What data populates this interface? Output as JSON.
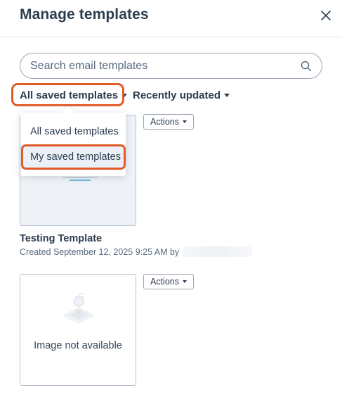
{
  "header": {
    "title": "Manage templates",
    "close_icon": "close-icon"
  },
  "search": {
    "placeholder": "Search email templates",
    "value": "",
    "icon": "search-icon"
  },
  "filters": {
    "owner_filter": {
      "label": "All saved templates",
      "icon": "caret-down-icon"
    },
    "sort_filter": {
      "label": "Recently updated",
      "icon": "caret-down-icon"
    }
  },
  "owner_dropdown": {
    "items": [
      {
        "label": "All saved templates",
        "state": "default"
      },
      {
        "label": "My saved templates",
        "state": "hovered"
      }
    ]
  },
  "templates": [
    {
      "name": "Testing Template",
      "created": "Created September 12, 2025 9:25 AM by",
      "actions_label": "Actions"
    },
    {
      "thumbnail_text": "Image not available",
      "actions_label": "Actions"
    }
  ],
  "colors": {
    "text": "#2d3e50",
    "highlight": "#e05b27",
    "border": "#b6c2d1",
    "hover": "#eaf0f6"
  }
}
